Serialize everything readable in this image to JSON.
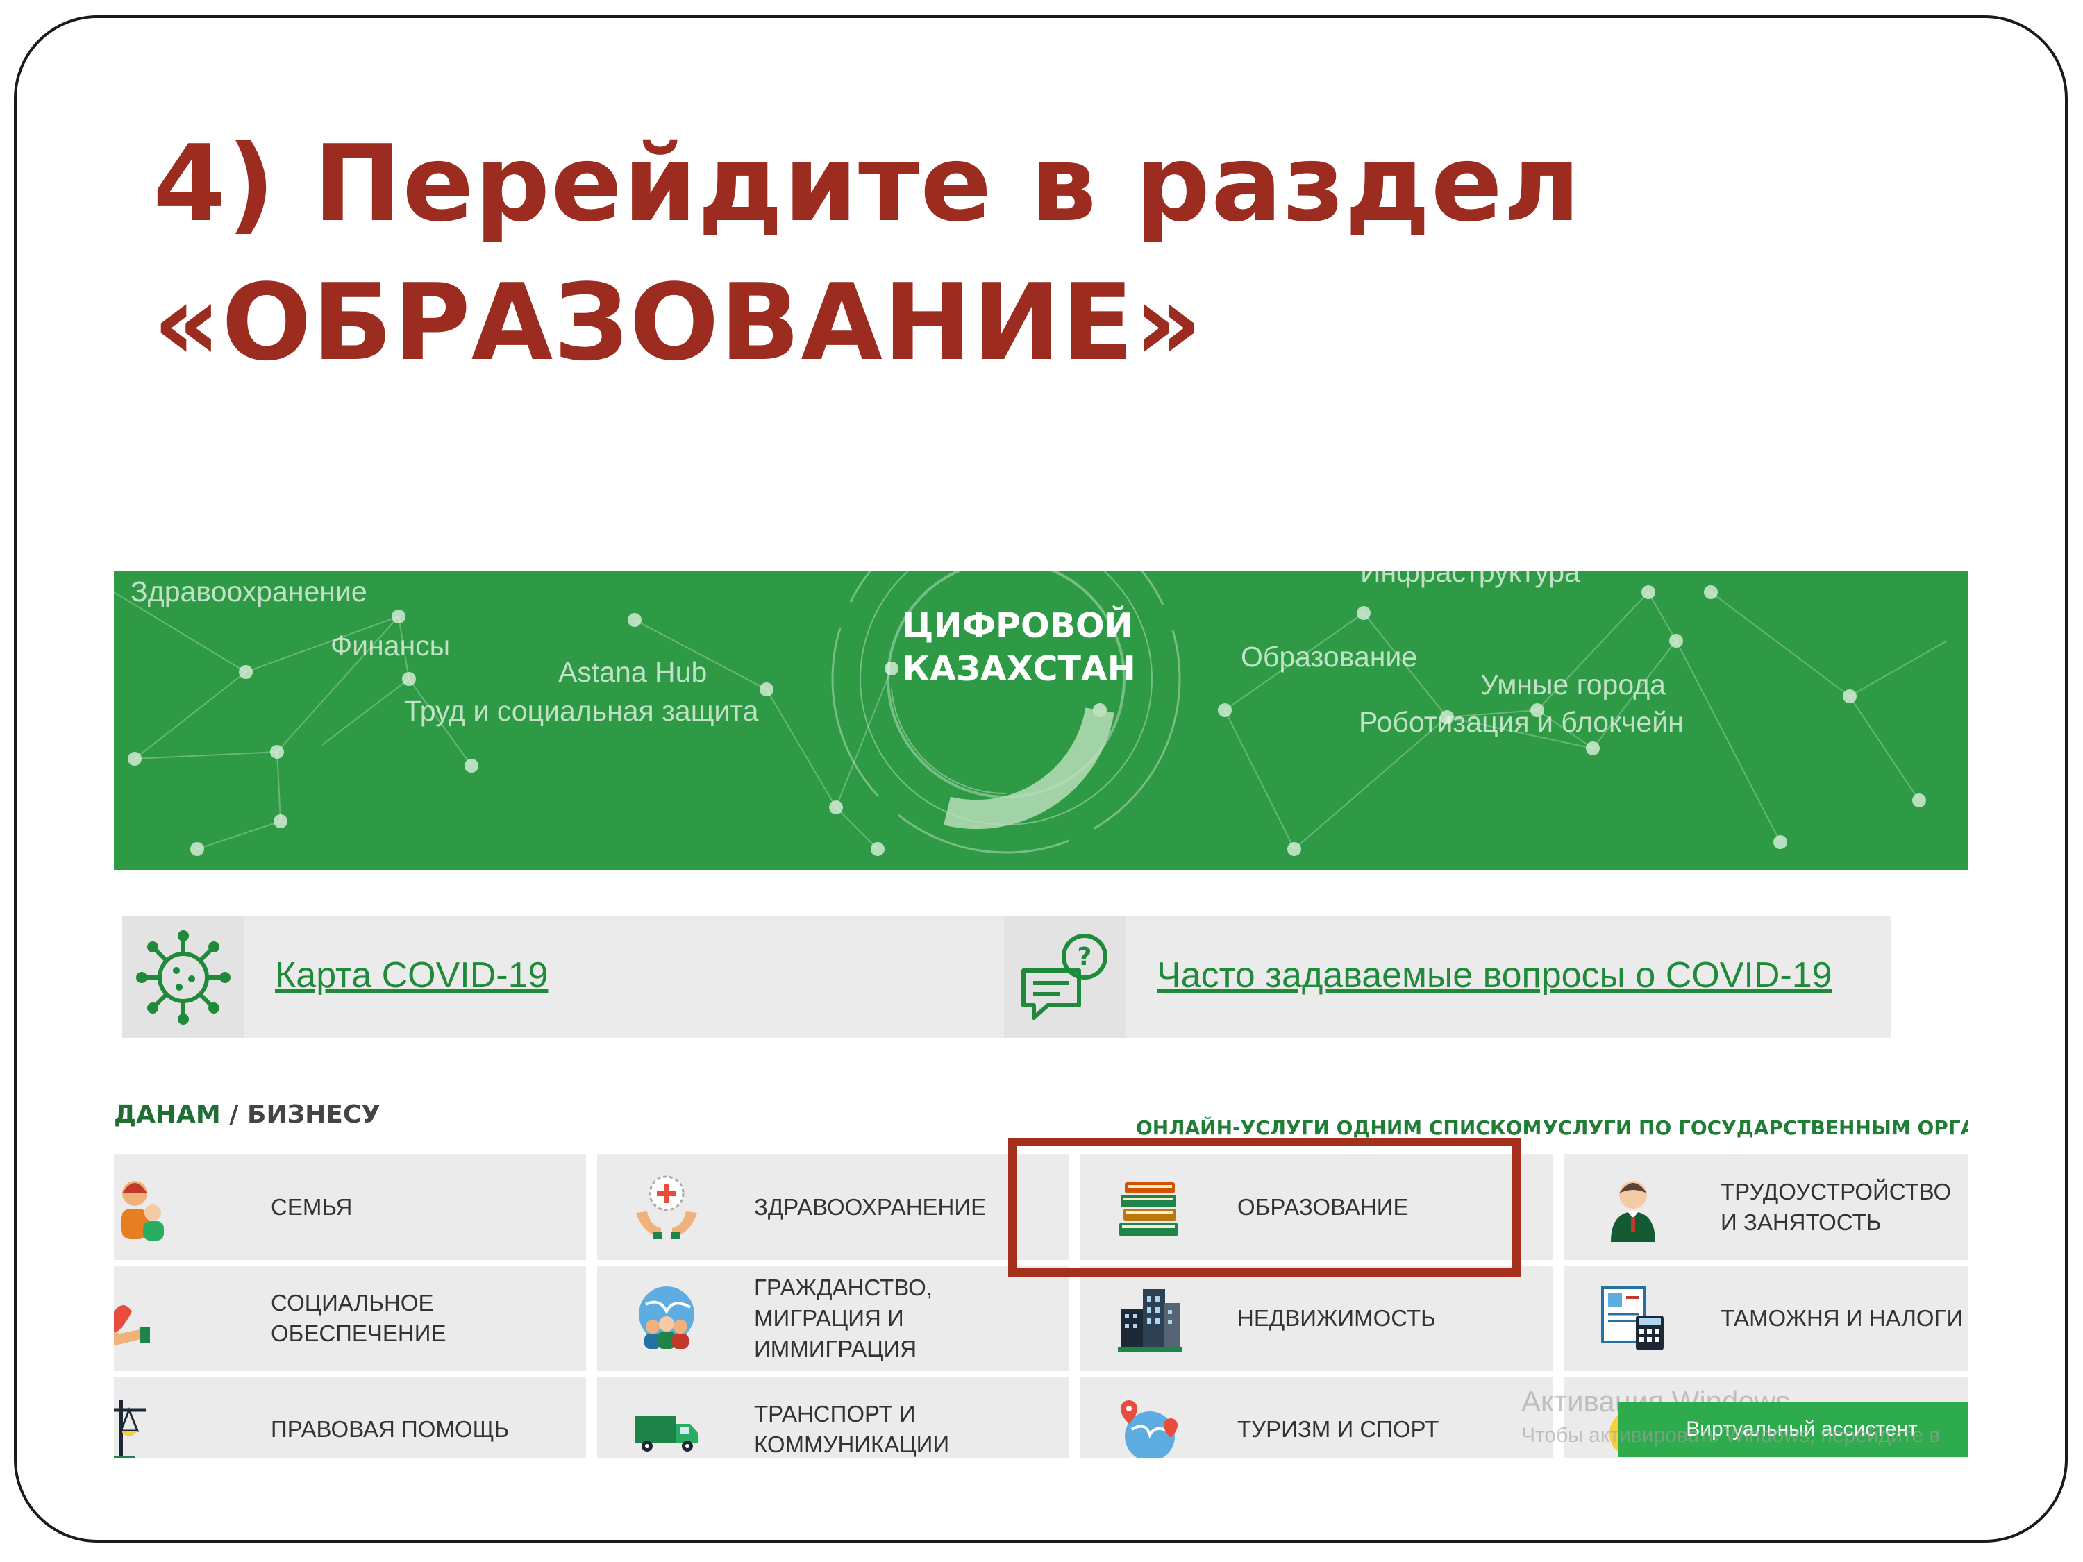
{
  "slide": {
    "title_line1": "4) Перейдите в раздел",
    "title_line2": "«ОБРАЗОВАНИЕ»"
  },
  "banner": {
    "title_line1": "ЦИФРОВОЙ",
    "title_line2": "КАЗАХСТАН",
    "words": {
      "health": "Здравоохранение",
      "finance": "Финансы",
      "astana_hub": "Astana Hub",
      "labor": "Труд и социальная защита",
      "infra": "Инфраструктура",
      "education": "Образование",
      "smart_cities": "Умные города",
      "robot": "Роботизация и блокчейн"
    }
  },
  "covid": {
    "map_link": "Карта COVID-19",
    "faq_link": "Часто задаваемые вопросы о COVID-19"
  },
  "section": {
    "citizens": "ДАНАМ",
    "separator": "/",
    "business": "БИЗНЕСУ",
    "online_services_link": "ОНЛАЙН-УСЛУГИ ОДНИМ СПИСКОМ",
    "gov_services_link": "УСЛУГИ ПО ГОСУДАРСТВЕННЫМ ОРГАНАМ",
    "chevron": "›"
  },
  "categories": [
    {
      "label": "СЕМЬЯ",
      "icon": "family-icon"
    },
    {
      "label": "ЗДРАВООХРАНЕНИЕ",
      "icon": "healthcare-icon"
    },
    {
      "label": "ОБРАЗОВАНИЕ",
      "icon": "books-icon"
    },
    {
      "label": "ТРУДОУСТРОЙСТВО И ЗАНЯТОСТЬ",
      "icon": "employee-icon"
    },
    {
      "label": "СОЦИАЛЬНОЕ ОБЕСПЕЧЕНИЕ",
      "icon": "social-care-icon"
    },
    {
      "label": "ГРАЖДАНСТВО, МИГРАЦИЯ И ИММИГРАЦИЯ",
      "icon": "globe-people-icon"
    },
    {
      "label": "НЕДВИЖИМОСТЬ",
      "icon": "buildings-icon"
    },
    {
      "label": "ТАМОЖНЯ И НАЛОГИ",
      "icon": "calculator-document-icon"
    },
    {
      "label": "ПРАВОВАЯ ПОМОЩЬ",
      "icon": "scales-icon"
    },
    {
      "label": "ТРАНСПОРТ И КОММУНИКАЦИИ",
      "icon": "truck-icon"
    },
    {
      "label": "ТУРИЗМ И СПОРТ",
      "icon": "globe-pins-icon"
    }
  ],
  "watermark": {
    "line1": "Активация Windows",
    "line2": "Чтобы активировать Windows, перейдите в"
  },
  "assistant_button": "Виртуальный ассистент",
  "colors": {
    "title": "#9b2c1f",
    "banner": "#2f9a45",
    "link": "#1f8a3a",
    "highlight": "#a5311c"
  }
}
